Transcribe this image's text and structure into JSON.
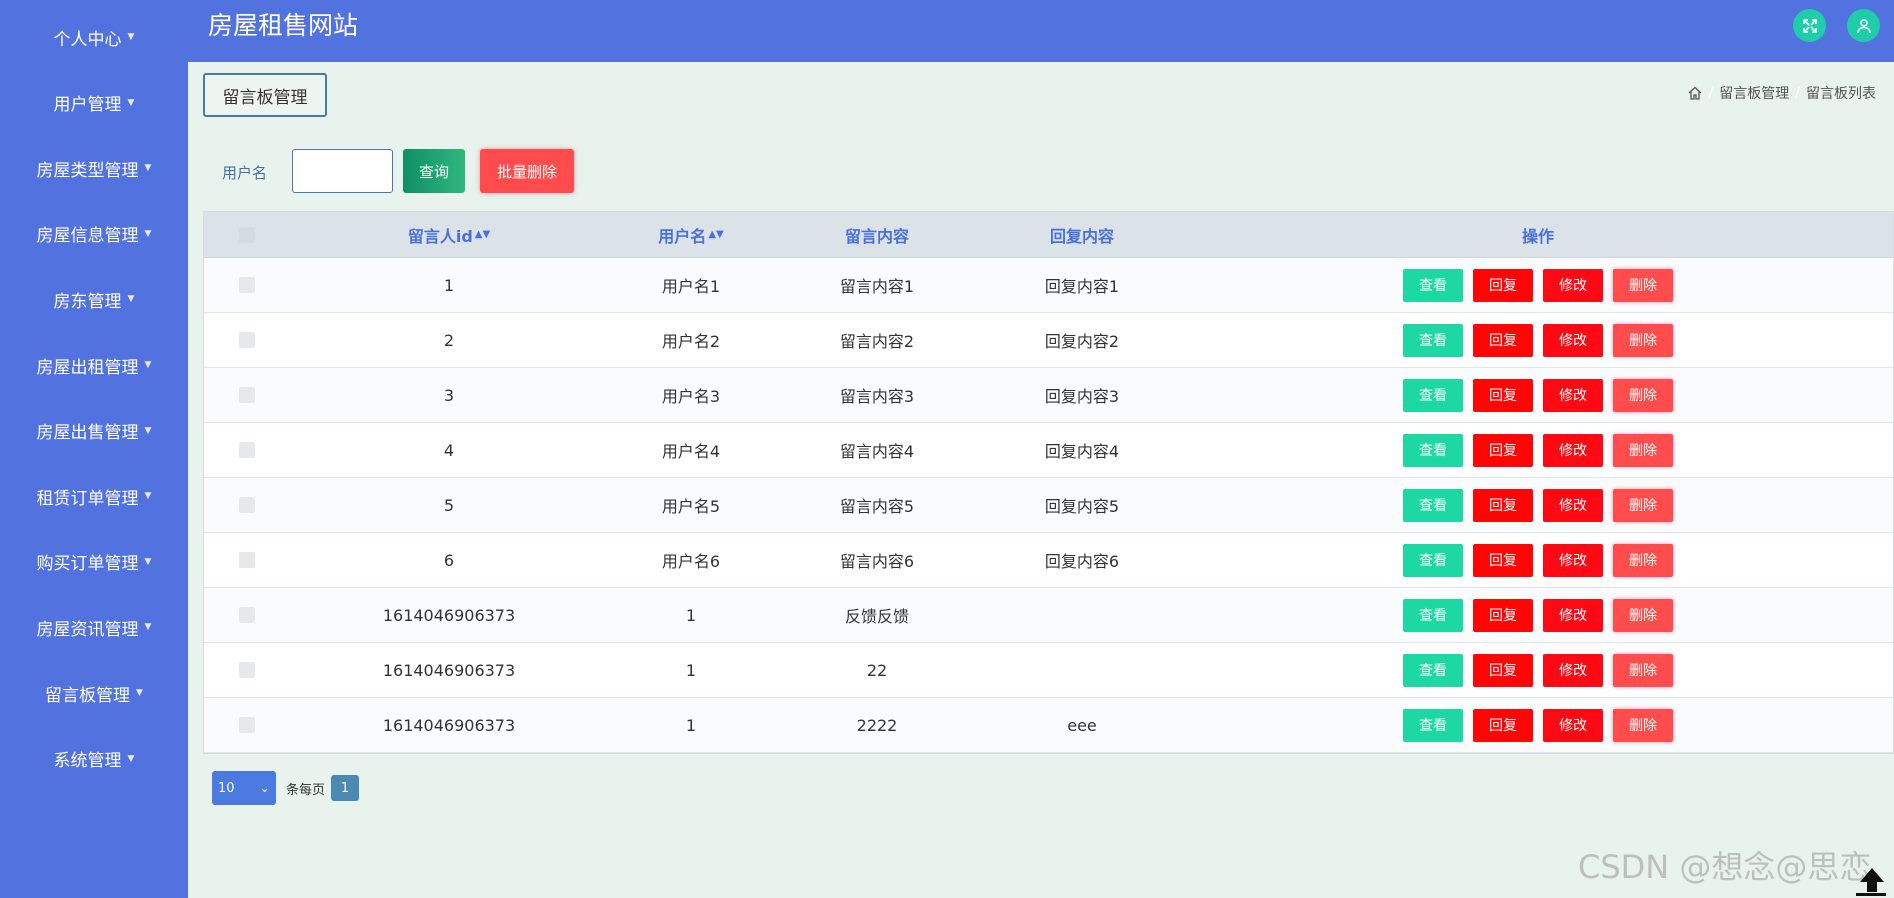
{
  "app": {
    "title": "房屋租售网站"
  },
  "colors": {
    "sidebar": "#5272e0",
    "view": "#1dd8a2",
    "reply": "#ff0505",
    "delete": "#ff4d4d",
    "accent": "#4a6fe0"
  },
  "sidebar": {
    "items": [
      {
        "label": "个人中心"
      },
      {
        "label": "用户管理"
      },
      {
        "label": "房屋类型管理"
      },
      {
        "label": "房屋信息管理"
      },
      {
        "label": "房东管理"
      },
      {
        "label": "房屋出租管理"
      },
      {
        "label": "房屋出售管理"
      },
      {
        "label": "租赁订单管理"
      },
      {
        "label": "购买订单管理"
      },
      {
        "label": "房屋资讯管理"
      },
      {
        "label": "留言板管理"
      },
      {
        "label": "系统管理"
      }
    ]
  },
  "header": {
    "icons": [
      "fullscreen-icon",
      "user-icon"
    ]
  },
  "page": {
    "section_title": "留言板管理",
    "breadcrumb": [
      "留言板管理",
      "留言板列表"
    ]
  },
  "search": {
    "label": "用户名",
    "value": "",
    "query_label": "查询",
    "batch_delete_label": "批量删除"
  },
  "table": {
    "columns": {
      "id": "留言人id",
      "username": "用户名",
      "content": "留言内容",
      "reply": "回复内容",
      "actions": "操作"
    },
    "rows": [
      {
        "id": "1",
        "username": "用户名1",
        "content": "留言内容1",
        "reply": "回复内容1"
      },
      {
        "id": "2",
        "username": "用户名2",
        "content": "留言内容2",
        "reply": "回复内容2"
      },
      {
        "id": "3",
        "username": "用户名3",
        "content": "留言内容3",
        "reply": "回复内容3"
      },
      {
        "id": "4",
        "username": "用户名4",
        "content": "留言内容4",
        "reply": "回复内容4"
      },
      {
        "id": "5",
        "username": "用户名5",
        "content": "留言内容5",
        "reply": "回复内容5"
      },
      {
        "id": "6",
        "username": "用户名6",
        "content": "留言内容6",
        "reply": "回复内容6"
      },
      {
        "id": "1614046906373",
        "username": "1",
        "content": "反馈反馈",
        "reply": ""
      },
      {
        "id": "1614046906373",
        "username": "1",
        "content": "22",
        "reply": ""
      },
      {
        "id": "1614046906373",
        "username": "1",
        "content": "2222",
        "reply": "eee"
      }
    ],
    "actions": {
      "view": "查看",
      "reply": "回复",
      "edit": "修改",
      "delete": "删除"
    }
  },
  "pagination": {
    "page_size": "10",
    "per_page_label": "条每页",
    "current_page": "1"
  },
  "watermark": "CSDN @想念@思恋"
}
